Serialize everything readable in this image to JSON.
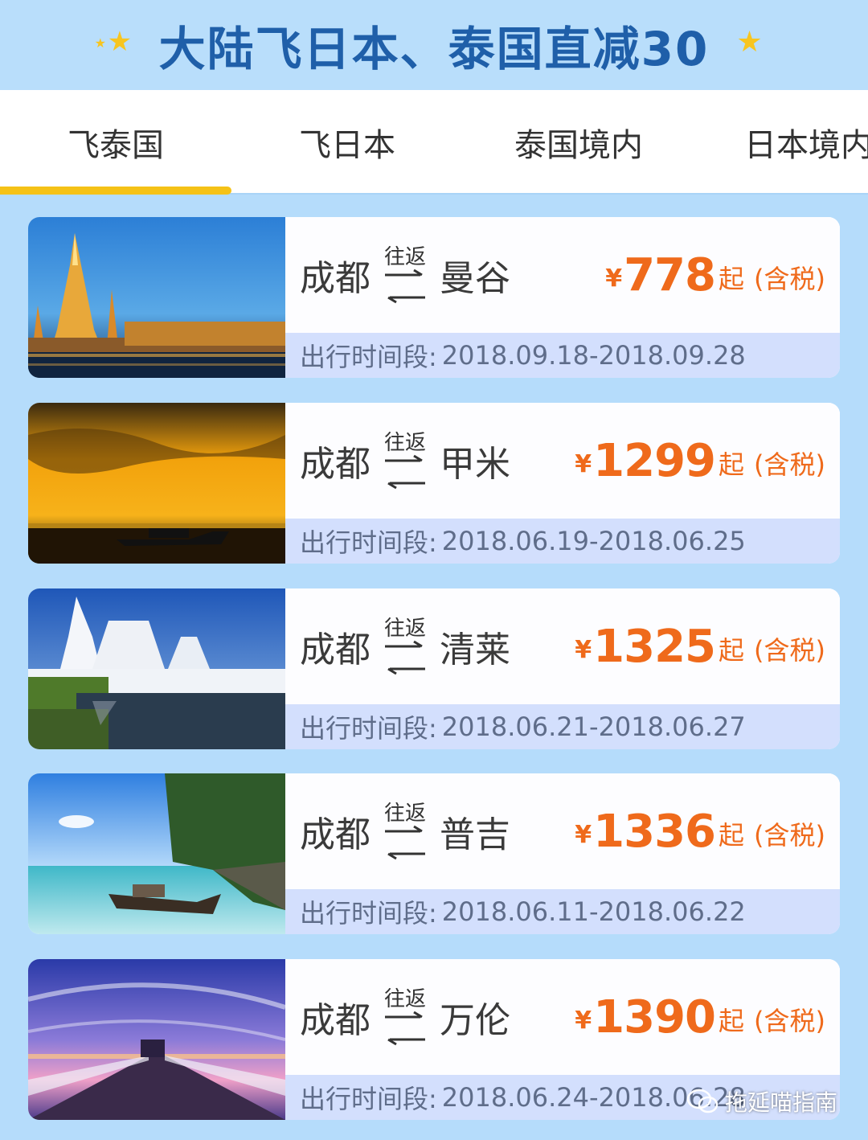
{
  "banner": {
    "title": "大陆飞日本、泰国直减30"
  },
  "tabs": [
    {
      "label": "飞泰国",
      "active": true
    },
    {
      "label": "飞日本",
      "active": false
    },
    {
      "label": "泰国境内",
      "active": false
    },
    {
      "label": "日本境内",
      "active": false
    }
  ],
  "colors": {
    "accent_price": "#ef6a1b",
    "tab_underline": "#f5c217",
    "title_blue": "#1f5fa9",
    "period_bg": "#d3dffd"
  },
  "round_trip_label": "往返",
  "currency": "¥",
  "price_suffix": "起",
  "tax_note": "(含税)",
  "period_label": "出行时间段:",
  "cards": [
    {
      "origin": "成都",
      "destination": "曼谷",
      "price": "778",
      "period": "2018.09.18-2018.09.28",
      "image": "temple-night"
    },
    {
      "origin": "成都",
      "destination": "甲米",
      "price": "1299",
      "period": "2018.06.19-2018.06.25",
      "image": "sunset-boat"
    },
    {
      "origin": "成都",
      "destination": "清莱",
      "price": "1325",
      "period": "2018.06.21-2018.06.27",
      "image": "white-temple"
    },
    {
      "origin": "成都",
      "destination": "普吉",
      "price": "1336",
      "period": "2018.06.11-2018.06.22",
      "image": "beach-longtail"
    },
    {
      "origin": "成都",
      "destination": "万伦",
      "price": "1390",
      "period": "2018.06.24-2018.06.28",
      "image": "pier-sunset"
    }
  ],
  "watermark": {
    "text": "拖延喵指南"
  }
}
